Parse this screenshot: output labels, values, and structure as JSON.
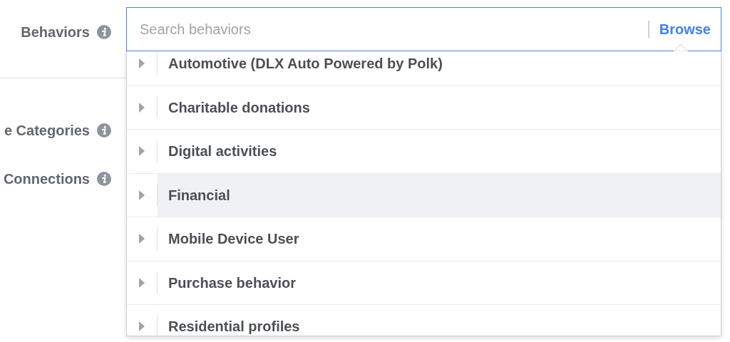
{
  "labels": [
    {
      "text": "Behaviors",
      "kind": "field"
    },
    {
      "text": "e Categories",
      "kind": "plain"
    },
    {
      "text": "Connections",
      "kind": "plain"
    }
  ],
  "search": {
    "placeholder": "Search behaviors",
    "action": "Browse"
  },
  "items": [
    {
      "label": "Automotive (DLX Auto Powered by Polk)",
      "expanded": false,
      "highlighted": false
    },
    {
      "label": "Charitable donations",
      "expanded": false,
      "highlighted": false
    },
    {
      "label": "Digital activities",
      "expanded": false,
      "highlighted": false
    },
    {
      "label": "Financial",
      "expanded": false,
      "highlighted": true
    },
    {
      "label": "Mobile Device User",
      "expanded": false,
      "highlighted": false
    },
    {
      "label": "Purchase behavior",
      "expanded": false,
      "highlighted": false
    },
    {
      "label": "Residential profiles",
      "expanded": false,
      "highlighted": false
    }
  ]
}
